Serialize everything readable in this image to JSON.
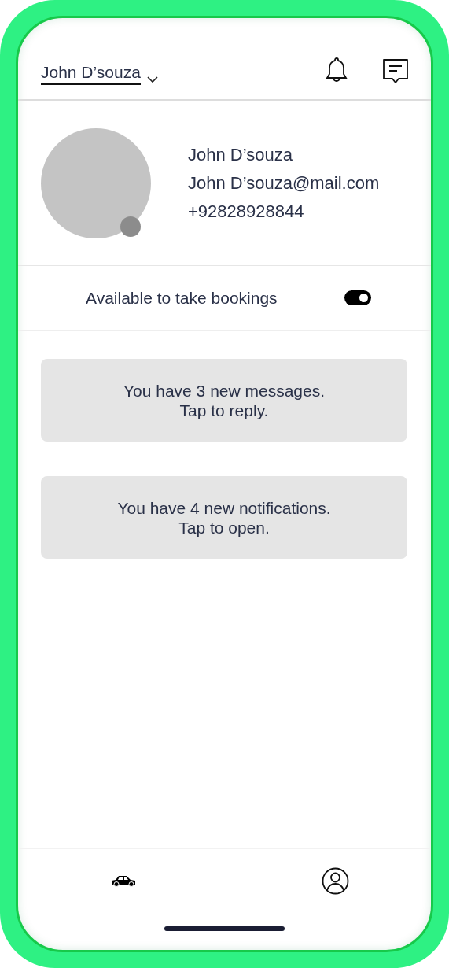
{
  "header": {
    "account_name": "John D’souza"
  },
  "profile": {
    "name": "John D’souza",
    "email": "John D’souza@mail.com",
    "phone": "+92828928844"
  },
  "availability": {
    "label": "Available to take bookings",
    "on": true
  },
  "cards": [
    {
      "lines": [
        "You have 3 new messages.",
        "Tap to reply."
      ]
    },
    {
      "lines": [
        "You have 4 new notifications.",
        "Tap to open."
      ]
    }
  ]
}
